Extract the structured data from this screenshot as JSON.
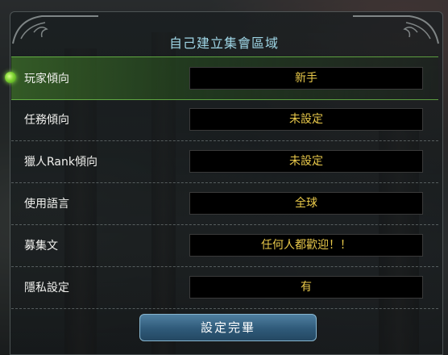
{
  "dialog": {
    "title": "自己建立集會區域",
    "rows": [
      {
        "label": "玩家傾向",
        "value": "新手"
      },
      {
        "label": "任務傾向",
        "value": "未設定"
      },
      {
        "label": "獵人Rank傾向",
        "value": "未設定"
      },
      {
        "label": "使用語言",
        "value": "全球"
      },
      {
        "label": "募集文",
        "value": "任何人都歡迎！！"
      },
      {
        "label": "隱私設定",
        "value": "有"
      }
    ],
    "confirm_label": "設定完畢"
  },
  "colors": {
    "title": "#9fd6e6",
    "value_text": "#e9c94a",
    "active_highlight": "#7fd233"
  }
}
